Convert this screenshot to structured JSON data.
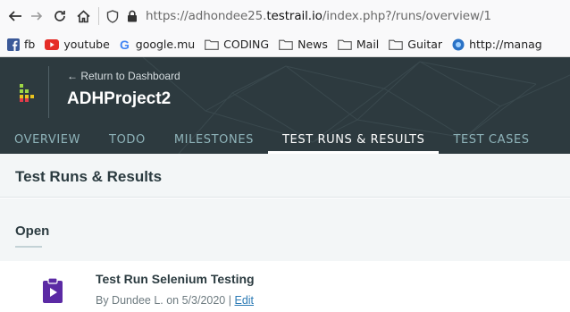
{
  "browser": {
    "url_prefix": "https://adhondee25.",
    "url_host": "testrail.io",
    "url_suffix": "/index.php?/runs/overview/1"
  },
  "bookmarks": [
    {
      "label": "fb",
      "icon": "facebook-icon"
    },
    {
      "label": "youtube",
      "icon": "youtube-icon"
    },
    {
      "label": "google.mu",
      "icon": "google-icon"
    },
    {
      "label": "CODING",
      "icon": "folder-icon"
    },
    {
      "label": "News",
      "icon": "folder-icon"
    },
    {
      "label": "Mail",
      "icon": "folder-icon"
    },
    {
      "label": "Guitar",
      "icon": "folder-icon"
    },
    {
      "label": "http://manag",
      "icon": "globe-icon"
    }
  ],
  "header": {
    "return_label": "← Return to Dashboard",
    "project_name": "ADHProject2",
    "tabs": [
      {
        "label": "OVERVIEW",
        "active": false
      },
      {
        "label": "TODO",
        "active": false
      },
      {
        "label": "MILESTONES",
        "active": false
      },
      {
        "label": "TEST RUNS & RESULTS",
        "active": true
      },
      {
        "label": "TEST CASES",
        "active": false
      }
    ]
  },
  "main": {
    "page_title": "Test Runs & Results",
    "section_title": "Open",
    "runs": [
      {
        "title": "Test Run Selenium Testing",
        "meta": "By Dundee L. on 5/3/2020",
        "separator": "|",
        "edit_label": "Edit"
      }
    ]
  },
  "colors": {
    "header_bg": "#2d3a3f",
    "tab_inactive": "#8fb4ba",
    "accent_link": "#2c7bb5",
    "run_icon": "#5b2aa4"
  }
}
